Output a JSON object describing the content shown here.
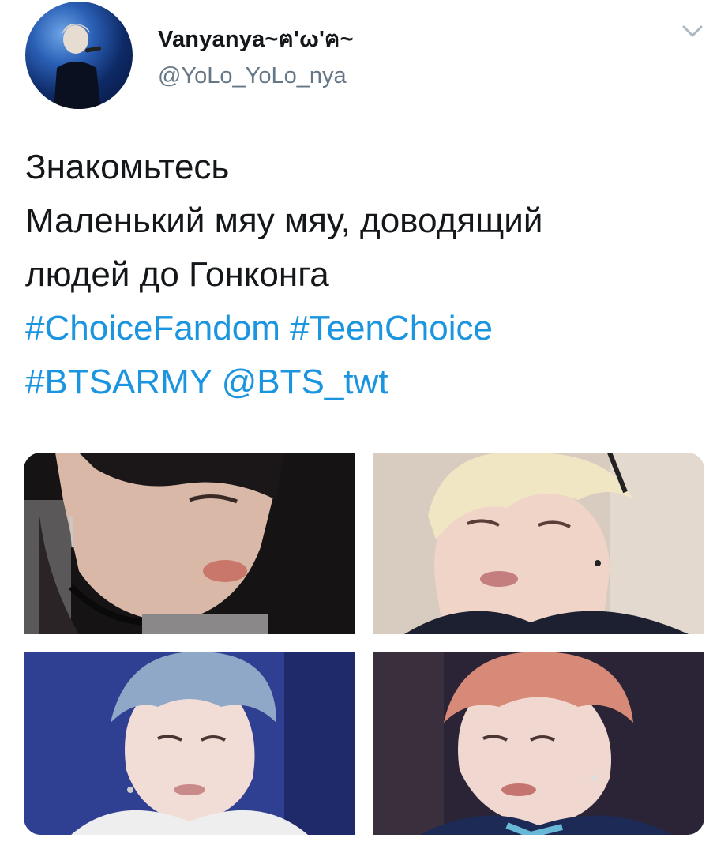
{
  "tweet": {
    "author": {
      "display_name": "Vanyanya~ฅ'ω'ฅ~",
      "handle": "@YoLo_YoLo_nya"
    },
    "text_lines": [
      "Знакомьтесь",
      "Маленький мяу мяу, доводящий",
      "людей до Гонконга"
    ],
    "hashtags": [
      "#ChoiceFandom",
      "#TeenChoice",
      "#BTSARMY"
    ],
    "mention": "@BTS_twt",
    "icons": {
      "avatar": "profile-avatar",
      "menu": "chevron-down-icon"
    },
    "colors": {
      "link": "#1b95e0",
      "text": "#14171a",
      "muted": "#657786"
    }
  }
}
